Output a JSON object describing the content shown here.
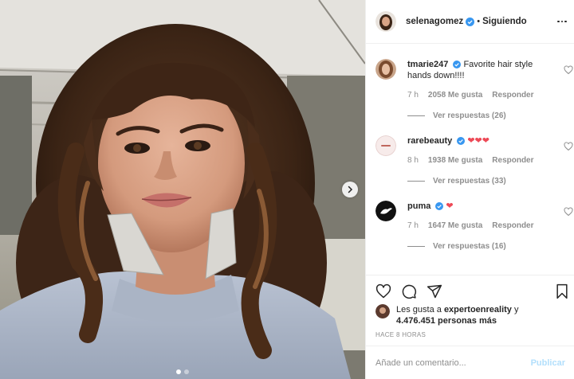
{
  "post": {
    "username": "selenagomez",
    "separator": "•",
    "follow_status": "Siguiendo",
    "photo_alt": "selfie photo",
    "carousel_count": 2
  },
  "comments": [
    {
      "user": "tmarie247",
      "verified": true,
      "text": "Favorite hair style hands down!!!!",
      "time": "7 h",
      "likes": "2058 Me gusta",
      "reply": "Responder",
      "view_replies": "Ver respuestas (26)"
    },
    {
      "user": "rarebeauty",
      "verified": true,
      "text": "❤❤❤",
      "time": "8 h",
      "likes": "1938 Me gusta",
      "reply": "Responder",
      "view_replies": "Ver respuestas (33)"
    },
    {
      "user": "puma",
      "verified": true,
      "text": "❤",
      "time": "7 h",
      "likes": "1647 Me gusta",
      "reply": "Responder",
      "view_replies": "Ver respuestas (16)"
    }
  ],
  "likes_summary": {
    "prefix": "Les gusta a ",
    "user": "expertoenreality",
    "suffix": " y",
    "count": "4.476.451 personas más"
  },
  "timestamp": "HACE 8 HORAS",
  "add_comment": {
    "placeholder": "Añade un comentario...",
    "publish_label": "Publicar"
  },
  "icons": {
    "like": "heart-icon",
    "comment": "comment-icon",
    "share": "share-icon",
    "save": "bookmark-icon",
    "more": "more-icon",
    "next": "chevron-right-icon"
  },
  "colors": {
    "verified": "#3897f0",
    "heart_red": "#ed4956",
    "muted": "#8e8e8e",
    "publish_disabled": "#b2dffc"
  }
}
